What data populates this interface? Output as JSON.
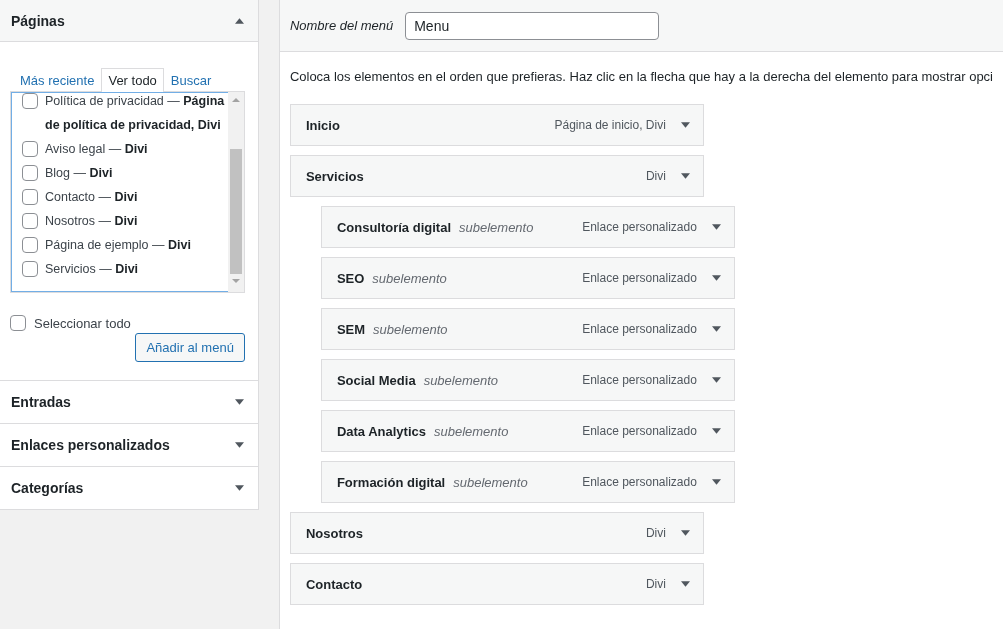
{
  "sidebar": {
    "sections": [
      {
        "title": "Páginas",
        "expanded": true,
        "tabs": [
          {
            "label": "Más reciente",
            "selected": false
          },
          {
            "label": "Ver todo",
            "selected": true
          },
          {
            "label": "Buscar",
            "selected": false
          }
        ],
        "pages": [
          {
            "label": "Política de privacidad — **Página de política de privacidad, Divi**",
            "checked": false
          },
          {
            "label": "Aviso legal — **Divi**",
            "checked": false
          },
          {
            "label": "Blog — **Divi**",
            "checked": false
          },
          {
            "label": "Contacto — **Divi**",
            "checked": false
          },
          {
            "label": "Nosotros — **Divi**",
            "checked": false
          },
          {
            "label": "Página de ejemplo — **Divi**",
            "checked": false
          },
          {
            "label": "Servicios — **Divi**",
            "checked": false
          }
        ],
        "select_all": {
          "label": "Seleccionar todo",
          "checked": false
        },
        "add_button": "Añadir al menú"
      },
      {
        "title": "Entradas",
        "expanded": false
      },
      {
        "title": "Enlaces personalizados",
        "expanded": false
      },
      {
        "title": "Categorías",
        "expanded": false
      }
    ]
  },
  "menu": {
    "name_label": "Nombre del menú",
    "name_value": "Menu",
    "instructions": "Coloca los elementos en el orden que prefieras. Haz clic en la flecha que hay a la derecha del elemento para mostrar opci",
    "items": [
      {
        "title": "Inicio",
        "type_label": "Página de inicio, Divi"
      },
      {
        "title": "Servicios",
        "type_label": "Divi",
        "children": [
          {
            "title": "Consultoría digital",
            "sublabel": "subelemento",
            "type_label": "Enlace personalizado"
          },
          {
            "title": "SEO",
            "sublabel": "subelemento",
            "type_label": "Enlace personalizado"
          },
          {
            "title": "SEM",
            "sublabel": "subelemento",
            "type_label": "Enlace personalizado"
          },
          {
            "title": "Social Media",
            "sublabel": "subelemento",
            "type_label": "Enlace personalizado"
          },
          {
            "title": "Data Analytics",
            "sublabel": "subelemento",
            "type_label": "Enlace personalizado"
          },
          {
            "title": "Formación digital",
            "sublabel": "subelemento",
            "type_label": "Enlace personalizado"
          }
        ]
      },
      {
        "title": "Nosotros",
        "type_label": "Divi"
      },
      {
        "title": "Contacto",
        "type_label": "Divi"
      }
    ]
  }
}
